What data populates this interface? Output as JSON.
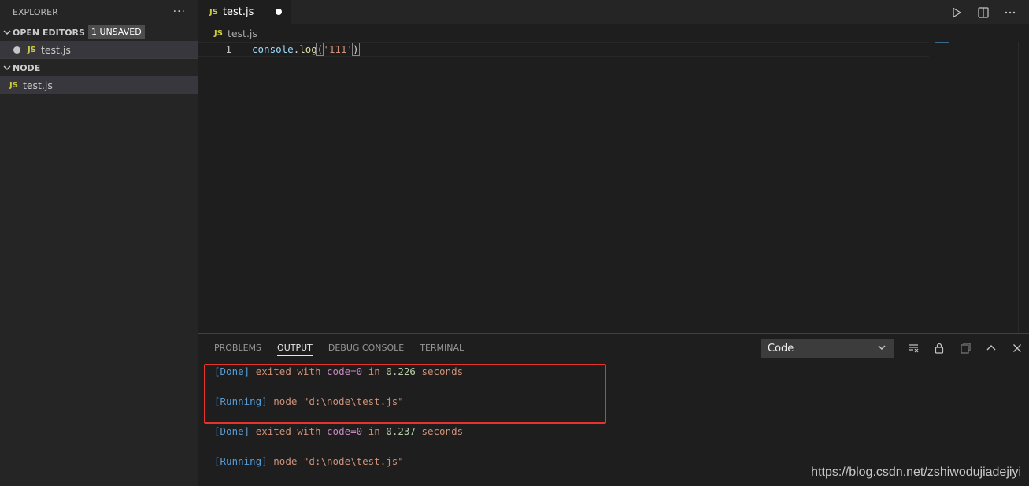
{
  "sidebar": {
    "title": "EXPLORER",
    "more_label": "···",
    "open_editors": {
      "label": "OPEN EDITORS",
      "badge": "1 UNSAVED",
      "items": [
        {
          "icon_text": "JS",
          "name": "test.js"
        }
      ]
    },
    "folder": {
      "label": "NODE",
      "items": [
        {
          "icon_text": "JS",
          "name": "test.js"
        }
      ]
    }
  },
  "editor": {
    "tab": {
      "icon_text": "JS",
      "label": "test.js",
      "modified": true
    },
    "breadcrumb": {
      "icon_text": "JS",
      "file": "test.js"
    },
    "lines": [
      {
        "number": "1",
        "tokens": [
          "console",
          ".",
          "log",
          "(",
          "'111'",
          ")"
        ]
      }
    ]
  },
  "panel": {
    "tabs": [
      "PROBLEMS",
      "OUTPUT",
      "DEBUG CONSOLE",
      "TERMINAL"
    ],
    "active_tab": "OUTPUT",
    "channel_select": "Code",
    "output": [
      {
        "bracket": "[Done]",
        "text1": "exited with",
        "code_key": "code=0",
        "in": "in",
        "num": "0.226",
        "text2": "seconds"
      },
      {
        "bracket": "[Running]",
        "text": "node \"d:\\node\\test.js\""
      },
      {
        "bracket": "[Done]",
        "text1": "exited with",
        "code_key": "code=0",
        "in": "in",
        "num": "0.237",
        "text2": "seconds"
      },
      {
        "bracket": "[Running]",
        "text": "node \"d:\\node\\test.js\""
      }
    ]
  },
  "watermark": "https://blog.csdn.net/zshiwodujiadejiyi",
  "colors": {
    "highlight_box": "#e8322e",
    "js_icon": "#cbcb41"
  }
}
